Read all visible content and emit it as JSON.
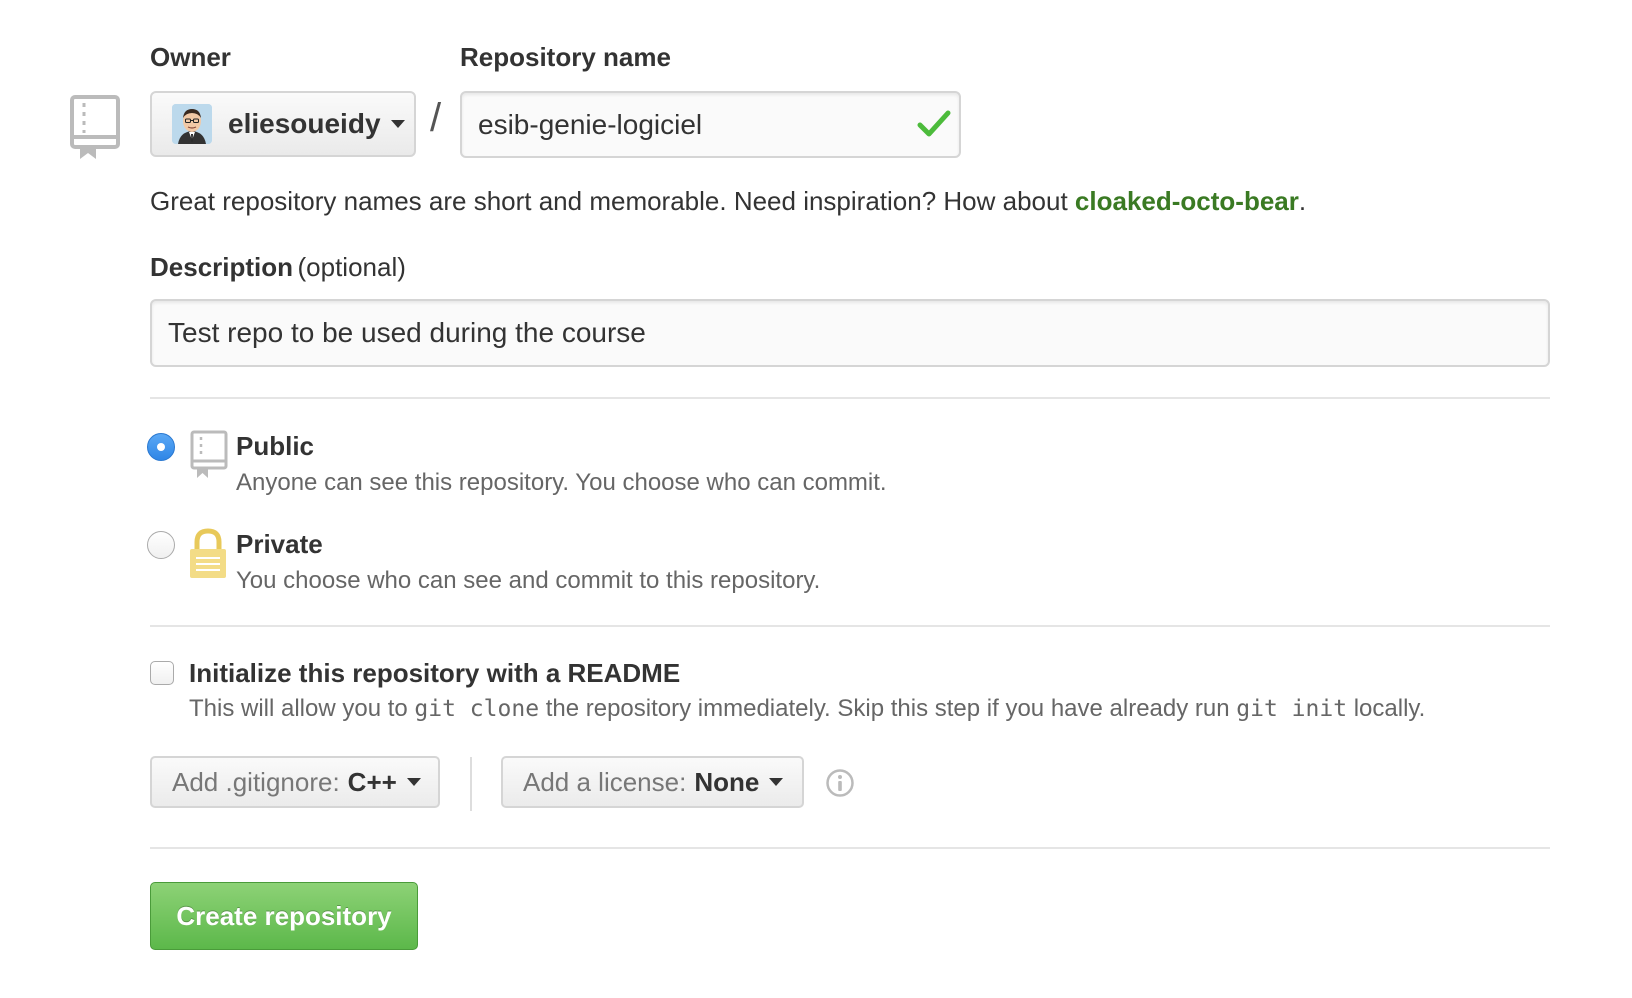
{
  "form": {
    "owner_label": "Owner",
    "repo_label": "Repository name",
    "owner_name": "eliesoueidy",
    "separator": "/",
    "repo_value": "esib-genie-logiciel",
    "helper_text": "Great repository names are short and memorable. Need inspiration? How about ",
    "suggestion": "cloaked-octo-bear",
    "helper_end": ".",
    "description_label": "Description",
    "description_optional": "(optional)",
    "description_value": "Test repo to be used during the course"
  },
  "visibility": {
    "public_title": "Public",
    "public_desc": "Anyone can see this repository. You choose who can commit.",
    "private_title": "Private",
    "private_desc": "You choose who can see and commit to this repository.",
    "selected": "public"
  },
  "readme": {
    "label": "Initialize this repository with a README",
    "desc_1": "This will allow you to ",
    "code_1": "git clone",
    "desc_2": " the repository immediately. Skip this step if you have already run ",
    "code_2": "git init",
    "desc_3": " locally.",
    "checked": false
  },
  "options": {
    "gitignore_label": "Add .gitignore:",
    "gitignore_value": "C++",
    "license_label": "Add a license:",
    "license_value": "None"
  },
  "actions": {
    "create_label": "Create repository"
  },
  "icons": {
    "repo": "repo-icon",
    "lock": "lock-icon",
    "check": "check-icon",
    "info": "info-icon",
    "caret": "caret-down-icon"
  },
  "colors": {
    "suggestion": "#3a7a23",
    "check": "#4cbb3b",
    "radio_selected": "#2f86e6",
    "create_button": "#5cb84a",
    "lock": "#e8c95a"
  }
}
